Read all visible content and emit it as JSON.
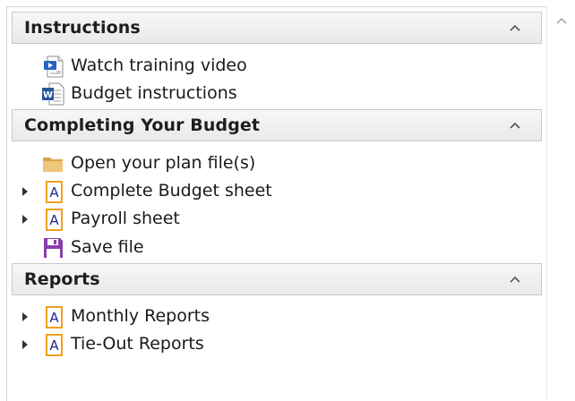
{
  "sections": [
    {
      "title": "Instructions",
      "items": [
        {
          "label": "Watch training video",
          "icon": "video-document-icon"
        },
        {
          "label": "Budget instructions",
          "icon": "word-document-icon"
        }
      ]
    },
    {
      "title": "Completing Your Budget",
      "items": [
        {
          "label": "Open your plan file(s)",
          "icon": "folder-icon"
        },
        {
          "label": "Complete Budget sheet",
          "icon": "sheet-a-icon"
        },
        {
          "label": "Payroll sheet",
          "icon": "sheet-a-icon"
        },
        {
          "label": "Save file",
          "icon": "floppy-disk-icon"
        }
      ]
    },
    {
      "title": "Reports",
      "items": [
        {
          "label": "Monthly Reports",
          "icon": "sheet-a-icon"
        },
        {
          "label": "Tie-Out Reports",
          "icon": "sheet-a-icon"
        }
      ]
    }
  ],
  "colors": {
    "header_bg": "#ececec",
    "header_border": "#c9c9c9",
    "sheet_icon_blue": "#1c2a8c",
    "sheet_icon_orange": "#f0a020",
    "folder_tan": "#e8b65a",
    "floppy_purple": "#8a3fa8"
  }
}
